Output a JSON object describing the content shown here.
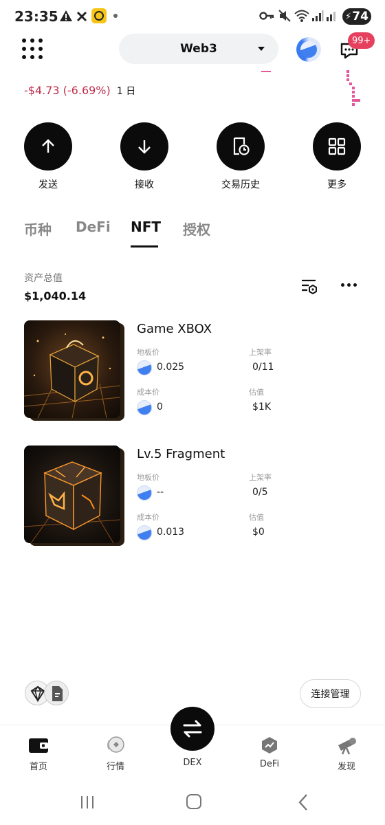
{
  "status_bar": {
    "time": "23:35",
    "battery": "74"
  },
  "header": {
    "wallet_name": "Web3",
    "message_badge": "99+"
  },
  "pnl": {
    "change": "-$4.73 (-6.69%)",
    "period": "1 日"
  },
  "actions": [
    {
      "label": "发送",
      "icon": "arrow-up-icon"
    },
    {
      "label": "接收",
      "icon": "arrow-down-icon"
    },
    {
      "label": "交易历史",
      "icon": "history-icon"
    },
    {
      "label": "更多",
      "icon": "grid-icon"
    }
  ],
  "tabs": [
    {
      "label": "币种",
      "active": false
    },
    {
      "label": "DeFi",
      "active": false
    },
    {
      "label": "NFT",
      "active": true
    },
    {
      "label": "授权",
      "active": false
    }
  ],
  "total": {
    "label": "资产总值",
    "value": "$1,040.14"
  },
  "nfts": [
    {
      "name": "Game XBOX",
      "floor_label": "地板价",
      "floor_value": "0.025",
      "listed_label": "上架率",
      "listed_value": "0/11",
      "cost_label": "成本价",
      "cost_value": "0",
      "est_label": "估值",
      "est_value": "$1K"
    },
    {
      "name": "Lv.5 Fragment",
      "floor_label": "地板价",
      "floor_value": "--",
      "listed_label": "上架率",
      "listed_value": "0/5",
      "cost_label": "成本价",
      "cost_value": "0.013",
      "est_label": "估值",
      "est_value": "$0"
    }
  ],
  "connection": {
    "manage_label": "连接管理"
  },
  "bottom_nav": [
    {
      "label": "首页",
      "icon": "wallet-icon"
    },
    {
      "label": "行情",
      "icon": "market-icon"
    },
    {
      "label": "DEX",
      "icon": "swap-icon"
    },
    {
      "label": "DeFi",
      "icon": "defi-icon"
    },
    {
      "label": "发现",
      "icon": "telescope-icon"
    }
  ],
  "colors": {
    "negative": "#c0304e",
    "badge": "#e5405e",
    "accent_blue": "#3f7ff0"
  }
}
